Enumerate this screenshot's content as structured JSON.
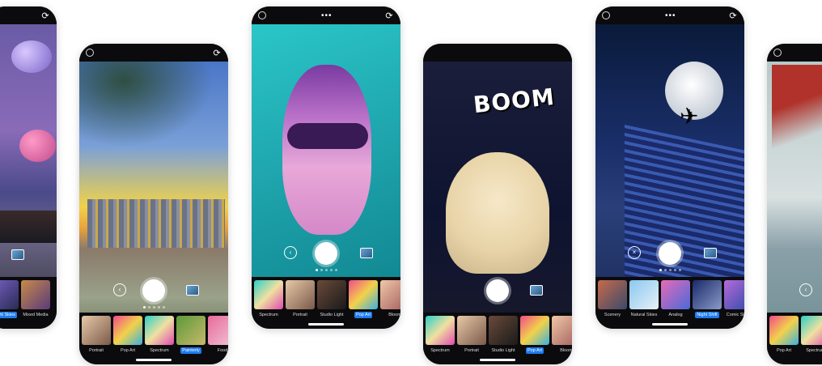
{
  "phones": [
    {
      "filters": [
        "Night Skies",
        "Mixed Media"
      ],
      "active": 0
    },
    {
      "filters": [
        "Portrait",
        "Pop Art",
        "Spectrum",
        "Painterly",
        "Food"
      ],
      "active": 3
    },
    {
      "filters": [
        "Spectrum",
        "Portrait",
        "Studio Light",
        "Pop Art",
        "Bloom"
      ],
      "active": 3
    },
    {
      "filters": [
        "Spectrum",
        "Portrait",
        "Studio Light",
        "Pop Art",
        "Bloom"
      ],
      "active": 3,
      "art_text": "BOOM"
    },
    {
      "filters": [
        "Scenery",
        "Natural Skies",
        "Analog",
        "Night Shift",
        "Comic Skies"
      ],
      "active": 3
    },
    {
      "filters": [
        "Pop Art",
        "Spectrum"
      ],
      "active": -1
    }
  ],
  "icons": {
    "top_left": "circle-settings-icon",
    "top_center": "more-dots-icon",
    "top_right": "refresh-icon",
    "shutter": "shutter-button",
    "switch": "camera-switch-icon",
    "gallery": "gallery-icon"
  },
  "colors": {
    "active_filter": "#1e7bf0",
    "phone_body": "#0b0b0d"
  }
}
